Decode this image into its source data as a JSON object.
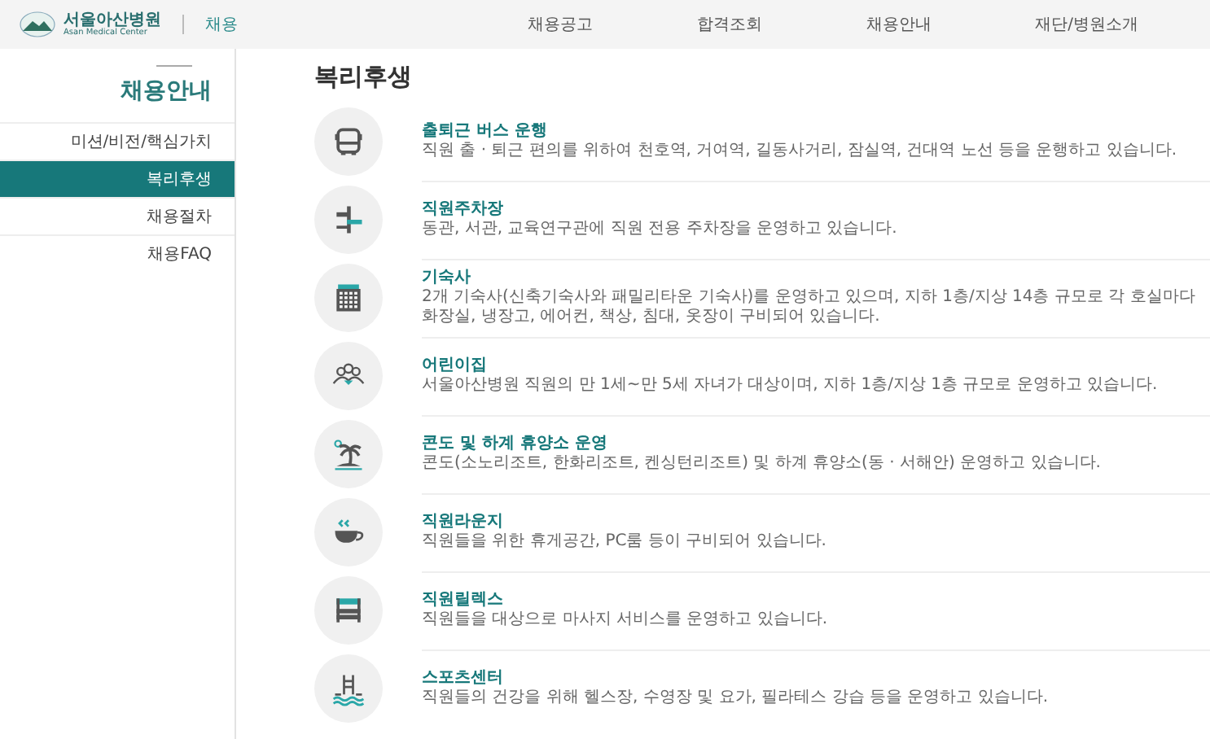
{
  "header": {
    "logo": {
      "name": "서울아산병원",
      "subtitle": "Asan Medical Center"
    },
    "section": "채용",
    "nav": [
      {
        "label": "채용공고",
        "selected": false
      },
      {
        "label": "합격조회",
        "selected": false
      },
      {
        "label": "채용안내",
        "selected": false
      },
      {
        "label": "재단/병원소개",
        "selected": false
      }
    ]
  },
  "sidebar": {
    "title": "채용안내",
    "items": [
      {
        "label": "미션/비전/핵심가치",
        "selected": false
      },
      {
        "label": "복리후생",
        "selected": true
      },
      {
        "label": "채용절차",
        "selected": false
      },
      {
        "label": "채용FAQ",
        "selected": false
      }
    ]
  },
  "page": {
    "title": "복리후생",
    "benefits": [
      {
        "kind": "bus",
        "title": "출퇴근 버스 운행",
        "description": "직원 출 · 퇴근 편의를 위하여 천호역, 거여역, 길동사거리, 잠실역, 건대역 노선 등을 운행하고 있습니다."
      },
      {
        "kind": "parking",
        "title": "직원주차장",
        "description": "동관, 서관, 교육연구관에 직원 전용 주차장을 운영하고 있습니다."
      },
      {
        "kind": "dormitory",
        "title": "기숙사",
        "description": "2개 기숙사(신축기숙사와 패밀리타운 기숙사)를 운영하고 있으며, 지하 1층/지상 14층 규모로 각 호실마다 화장실, 냉장고, 에어컨, 책상, 침대, 옷장이 구비되어 있습니다."
      },
      {
        "kind": "daycare",
        "title": "어린이집",
        "description": "서울아산병원 직원의 만 1세~만 5세 자녀가 대상이며, 지하 1층/지상 1층 규모로 운영하고 있습니다."
      },
      {
        "kind": "resort",
        "title": "콘도 및 하계 휴양소 운영",
        "description": "콘도(소노리조트, 한화리조트, 켄싱턴리조트) 및 하계 휴양소(동 · 서해안) 운영하고 있습니다."
      },
      {
        "kind": "lounge",
        "title": "직원라운지",
        "description": "직원들을 위한 휴게공간, PC룸 등이 구비되어 있습니다."
      },
      {
        "kind": "relax",
        "title": "직원릴렉스",
        "description": "직원들을 대상으로 마사지 서비스를 운영하고 있습니다."
      },
      {
        "kind": "sports",
        "title": "스포츠센터",
        "description": "직원들의 건강을 위해 헬스장, 수영장 및 요가, 필라테스 강습 등을 운영하고 있습니다."
      }
    ]
  }
}
